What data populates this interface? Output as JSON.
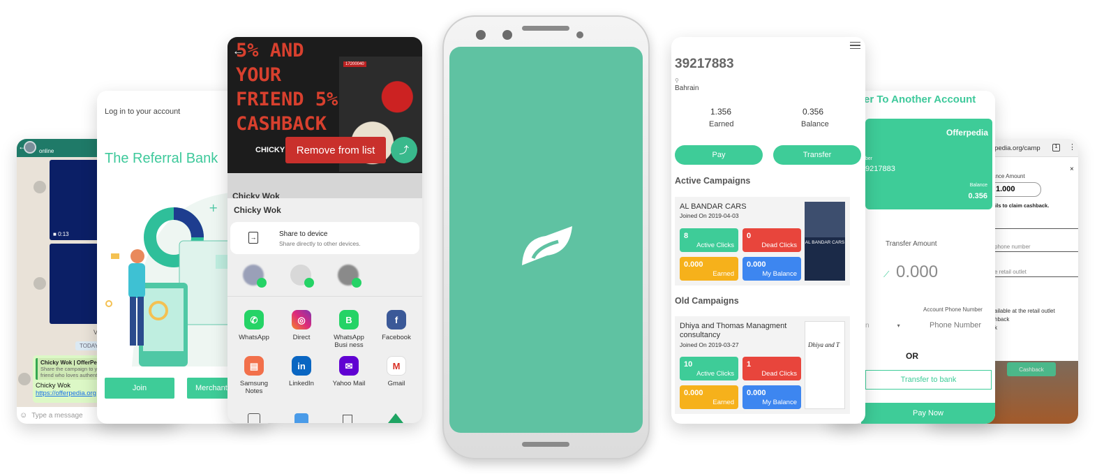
{
  "whatsapp": {
    "status": "online",
    "video_duration": "0:13",
    "date_badge": "TODAY",
    "quote_title": "Chicky Wok | OfferPedia",
    "quote_text": "Share the campaign to your friend who loves authentic",
    "msg_name": "Chicky Wok",
    "msg_link": "https://offerpedia.org",
    "msg_suffix": "V",
    "input_placeholder": "Type a message"
  },
  "referral": {
    "login_label": "Log in to your account",
    "title": "The Referral Bank",
    "join_label": "Join",
    "merchant_label": "Merchant"
  },
  "share": {
    "banner_line1": "5% AND",
    "banner_line2": "YOUR",
    "banner_line3": "FRIEND 5%",
    "banner_line4": "CASHBACK",
    "banner_brand": "CHICKY W",
    "badge": "17200040",
    "remove_label": "Remove from list",
    "peek_title": "Chicky Wok",
    "sheet_title": "Chicky Wok",
    "device_title": "Share to device",
    "device_sub": "Share directly to other devices.",
    "apps": [
      {
        "label": "WhatsApp",
        "color": "#25d366",
        "glyph": "✆"
      },
      {
        "label": "Direct",
        "color": "#d6249f",
        "glyph": "◎"
      },
      {
        "label": "WhatsApp Busi ness",
        "color": "#25d366",
        "glyph": "B"
      },
      {
        "label": "Facebook",
        "color": "#3b5998",
        "glyph": "f"
      },
      {
        "label": "Samsung Notes",
        "color": "#f2704b",
        "glyph": "▤"
      },
      {
        "label": "LinkedIn",
        "color": "#0a66c2",
        "glyph": "in"
      },
      {
        "label": "Yahoo Mail",
        "color": "#6001d2",
        "glyph": "✉"
      },
      {
        "label": "Gmail",
        "color": "#ffffff",
        "glyph": "M"
      }
    ]
  },
  "account": {
    "phone": "39217883",
    "location": "Bahrain",
    "earned_value": "1.356",
    "earned_label": "Earned",
    "balance_value": "0.356",
    "balance_label": "Balance",
    "pay_label": "Pay",
    "transfer_label": "Transfer",
    "active_heading": "Active Campaigns",
    "old_heading": "Old Campaigns",
    "active": {
      "name": "AL BANDAR CARS",
      "joined": "Joined On 2019-04-03",
      "active_clicks": "8",
      "dead_clicks": "0",
      "earned": "0.000",
      "balance": "0.000",
      "thumb_text": "AL BANDAR CARS"
    },
    "old": {
      "name": "Dhiya and Thomas Managment consultancy",
      "joined": "Joined On 2019-03-27",
      "active_clicks": "10",
      "dead_clicks": "1",
      "earned": "0.000",
      "balance": "0.000",
      "thumb_text": "Dhiya and T"
    },
    "tile_labels": {
      "active": "Active Clicks",
      "dead": "Dead Clicks",
      "earned": "Earned",
      "balance": "My Balance"
    }
  },
  "transfer": {
    "title": "er To Another Account",
    "brand": "Offerpedia",
    "number_label": "ber",
    "number": "9217883",
    "balance_label": "Balance",
    "balance": "0.356",
    "amount_label": "Transfer Amount",
    "amount": "0.000",
    "phone_hint": "Account Phone Number",
    "country": "n",
    "phone_placeholder": "Phone Number",
    "or": "OR",
    "bank_label": "Transfer to bank",
    "pay_now": "Pay Now"
  },
  "browser": {
    "url": "rpedia.org/camp",
    "balance_label": "ance Amount",
    "balance_value": "1.000",
    "claim_text": "ails to claim cashback.",
    "phone_placeholder": "phone number",
    "outlet_placeholder": "e retail outlet",
    "line1": "ailable at the retail outlet",
    "line2": "hback",
    "line3": "k",
    "cashback_label": "Cashback"
  },
  "colors": {
    "accent": "#3ecc98",
    "red": "#e8453c",
    "yellow": "#f6b11b",
    "blue": "#3d86f0",
    "phone_screen": "#5fc2a2"
  }
}
